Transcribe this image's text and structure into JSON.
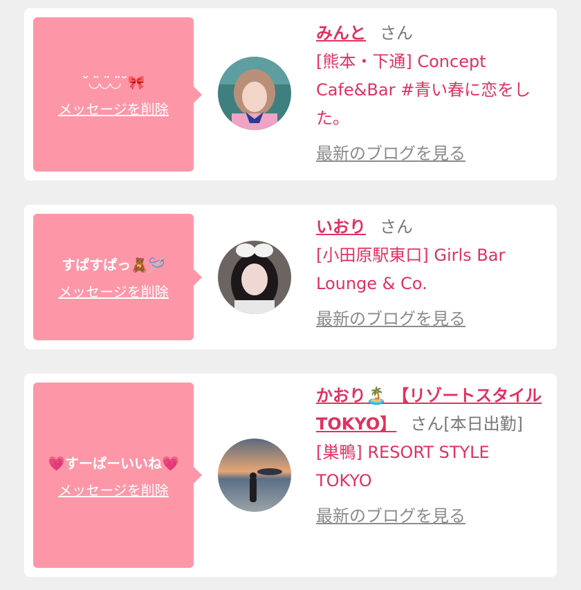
{
  "cards": [
    {
      "bubble_message": "˘◡̈◡̈◡̈˘🎀",
      "delete_label": "メッセージを削除",
      "name": "みんと",
      "honorific": "さん",
      "shop": "[熊本・下通] Concept Cafe&Bar #青い春に恋をした。",
      "blog_label": "最新のブログを見る"
    },
    {
      "bubble_message": "すぱすぱっ🧸🪡",
      "delete_label": "メッセージを削除",
      "name": "いおり",
      "honorific": "さん",
      "shop": "[小田原駅東口] Girls Bar Lounge & Co.",
      "blog_label": "最新のブログを見る"
    },
    {
      "bubble_message": "💗すーぱーいいね💗",
      "delete_label": "メッセージを削除",
      "name": "かおり🏝️ 【リゾートスタイルTOKYO】",
      "honorific": "さん[本日出勤]",
      "shop": "[巣鴨] RESORT STYLE TOKYO",
      "blog_label": "最新のブログを見る"
    }
  ]
}
